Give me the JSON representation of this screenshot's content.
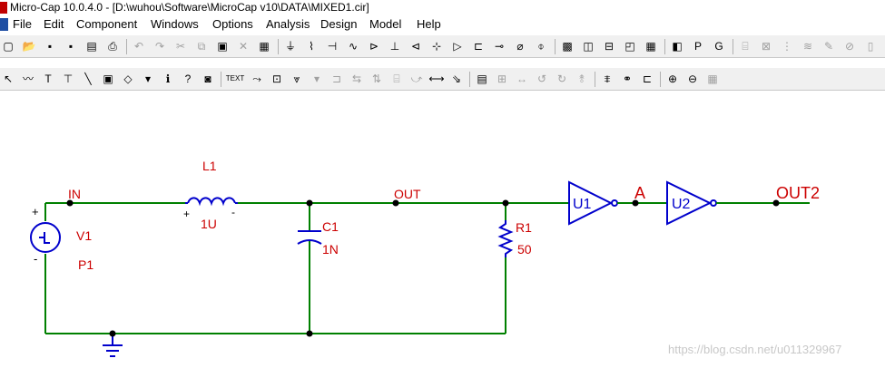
{
  "window": {
    "title": "Micro-Cap 10.0.4.0 - [D:\\wuhou\\Software\\MicroCap v10\\DATA\\MIXED1.cir]"
  },
  "menu": [
    "File",
    "Edit",
    "Component",
    "Windows",
    "Options",
    "Analysis",
    "Design",
    "Model",
    "Help"
  ],
  "toolbar1": [
    {
      "name": "new-file-icon",
      "glyph": "▢",
      "dim": false
    },
    {
      "name": "open-folder-icon",
      "glyph": "📂",
      "dim": false
    },
    {
      "name": "save-icon",
      "glyph": "▪",
      "dim": false
    },
    {
      "name": "save-all-icon",
      "glyph": "▪",
      "dim": false
    },
    {
      "name": "print-preview-icon",
      "glyph": "▤",
      "dim": false
    },
    {
      "name": "print-icon",
      "glyph": "⎙",
      "dim": false
    },
    {
      "name": "undo-icon",
      "glyph": "↶",
      "dim": true
    },
    {
      "name": "redo-icon",
      "glyph": "↷",
      "dim": true
    },
    {
      "name": "cut-icon",
      "glyph": "✂",
      "dim": true
    },
    {
      "name": "copy-icon",
      "glyph": "⧉",
      "dim": true
    },
    {
      "name": "paste-icon",
      "glyph": "▣",
      "dim": false
    },
    {
      "name": "delete-icon",
      "glyph": "✕",
      "dim": true
    },
    {
      "name": "select-all-icon",
      "glyph": "▦",
      "dim": false
    },
    {
      "name": "ground-icon",
      "glyph": "⏚",
      "dim": false
    },
    {
      "name": "resistor-icon",
      "glyph": "⌇",
      "dim": false
    },
    {
      "name": "capacitor-icon",
      "glyph": "⊣",
      "dim": false
    },
    {
      "name": "inductor-icon",
      "glyph": "∿",
      "dim": false
    },
    {
      "name": "diode-icon",
      "glyph": "⊳",
      "dim": false
    },
    {
      "name": "battery-icon",
      "glyph": "⊥",
      "dim": false
    },
    {
      "name": "zener-icon",
      "glyph": "⊲",
      "dim": false
    },
    {
      "name": "transistor-icon",
      "glyph": "⊹",
      "dim": false
    },
    {
      "name": "opamp-icon",
      "glyph": "▷",
      "dim": false
    },
    {
      "name": "switch-icon",
      "glyph": "⊏",
      "dim": false
    },
    {
      "name": "wire-icon",
      "glyph": "⊸",
      "dim": false
    },
    {
      "name": "node-icon",
      "glyph": "⌀",
      "dim": false
    },
    {
      "name": "source-icon",
      "glyph": "⌽",
      "dim": false
    },
    {
      "name": "cascade-windows-icon",
      "glyph": "▩",
      "dim": false
    },
    {
      "name": "tile-vertical-icon",
      "glyph": "◫",
      "dim": false
    },
    {
      "name": "tile-horizontal-icon",
      "glyph": "⊟",
      "dim": false
    },
    {
      "name": "split-window-icon",
      "glyph": "◰",
      "dim": false
    },
    {
      "name": "calculator-icon",
      "glyph": "▦",
      "dim": false
    },
    {
      "name": "component-panel-icon",
      "glyph": "◧",
      "dim": false
    },
    {
      "name": "page-text-icon",
      "glyph": "P",
      "dim": false
    },
    {
      "name": "grid-text-icon",
      "glyph": "G",
      "dim": false
    },
    {
      "name": "attribute-icon",
      "glyph": "⌸",
      "dim": true
    },
    {
      "name": "image-icon",
      "glyph": "⊠",
      "dim": true
    },
    {
      "name": "format-icon",
      "glyph": "⋮",
      "dim": true
    },
    {
      "name": "wave-icon",
      "glyph": "≋",
      "dim": true
    },
    {
      "name": "pencil-icon",
      "glyph": "✎",
      "dim": true
    },
    {
      "name": "zoom-lens-icon",
      "glyph": "⊘",
      "dim": true
    },
    {
      "name": "panel-icon",
      "glyph": "▯",
      "dim": true
    }
  ],
  "toolbar2": [
    {
      "name": "select-mode-icon",
      "glyph": "↖",
      "dim": false
    },
    {
      "name": "wire-mode-icon",
      "glyph": "〰",
      "dim": false
    },
    {
      "name": "text-mode-icon",
      "glyph": "T",
      "dim": false
    },
    {
      "name": "orthogonal-wire-icon",
      "glyph": "⊤",
      "dim": false
    },
    {
      "name": "diagonal-wire-icon",
      "glyph": "╲",
      "dim": false
    },
    {
      "name": "flag-icon",
      "glyph": "▣",
      "dim": false
    },
    {
      "name": "shape-icon",
      "glyph": "◇",
      "dim": false
    },
    {
      "name": "dropdown-arrow-icon",
      "glyph": "▾",
      "dim": false
    },
    {
      "name": "info-icon",
      "glyph": "ℹ",
      "dim": false
    },
    {
      "name": "help-icon",
      "glyph": "?",
      "dim": false
    },
    {
      "name": "probe-icon",
      "glyph": "◙",
      "dim": false
    },
    {
      "name": "text-toggle-icon",
      "glyph": "TEXT",
      "dim": false
    },
    {
      "name": "node-numbers-icon",
      "glyph": "⤳",
      "dim": false
    },
    {
      "name": "attribute-text-icon",
      "glyph": "⊡",
      "dim": false
    },
    {
      "name": "pin-connections-icon",
      "glyph": "⩔",
      "dim": false
    },
    {
      "name": "dropdown-arrow-2-icon",
      "glyph": "▾",
      "dim": true
    },
    {
      "name": "rotate-icon",
      "glyph": "⊐",
      "dim": true
    },
    {
      "name": "mirror-icon",
      "glyph": "⇆",
      "dim": true
    },
    {
      "name": "flip-icon",
      "glyph": "⇅",
      "dim": true
    },
    {
      "name": "box-icon",
      "glyph": "⌸",
      "dim": true
    },
    {
      "name": "step-icon",
      "glyph": "⤻",
      "dim": true
    },
    {
      "name": "connect-icon",
      "glyph": "⟷",
      "dim": false
    },
    {
      "name": "move-icon",
      "glyph": "⇘",
      "dim": false
    },
    {
      "name": "properties-icon",
      "glyph": "▤",
      "dim": false
    },
    {
      "name": "align-icon",
      "glyph": "⊞",
      "dim": true
    },
    {
      "name": "space-icon",
      "glyph": "↔",
      "dim": true
    },
    {
      "name": "rotate-left-icon",
      "glyph": "↺",
      "dim": true
    },
    {
      "name": "rotate-right-icon",
      "glyph": "↻",
      "dim": true
    },
    {
      "name": "flip-vertical-icon",
      "glyph": "⥉",
      "dim": true
    },
    {
      "name": "sweep-icon",
      "glyph": "⩨",
      "dim": false
    },
    {
      "name": "binoculars-icon",
      "glyph": "⚭",
      "dim": false
    },
    {
      "name": "goto-icon",
      "glyph": "⊏",
      "dim": false
    },
    {
      "name": "zoom-in-icon",
      "glyph": "⊕",
      "dim": false
    },
    {
      "name": "zoom-out-icon",
      "glyph": "⊖",
      "dim": false
    },
    {
      "name": "zoom-fit-icon",
      "glyph": "▦",
      "dim": true
    }
  ],
  "schematic": {
    "wire_color": "#008000",
    "component_color": "#cc0000",
    "digital_color": "#0000cc",
    "node_color": "#000000",
    "labels": {
      "in_node": "IN",
      "out_node": "OUT",
      "a_node": "A",
      "out2_node": "OUT2",
      "l1_name": "L1",
      "l1_value": "1U",
      "c1_name": "C1",
      "c1_value": "1N",
      "r1_name": "R1",
      "r1_value": "50",
      "v1_name": "V1",
      "v1_value": "P1",
      "u1_name": "U1",
      "u2_name": "U2",
      "plus": "+",
      "minus": "-"
    }
  },
  "watermark": "https://blog.csdn.net/u011329967"
}
